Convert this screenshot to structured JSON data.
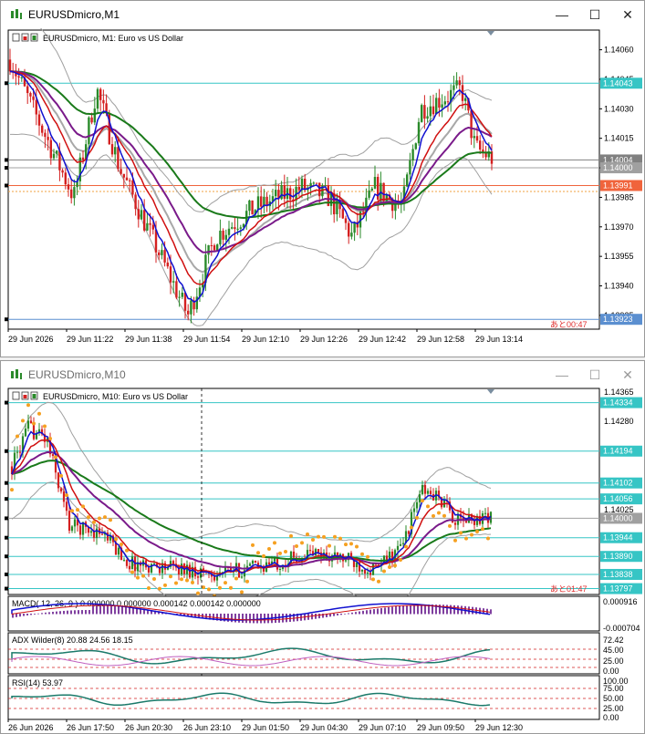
{
  "window1": {
    "title": "EURUSDmicro,M1",
    "chart_header": "EURUSDmicro, M1:  Euro vs US Dollar",
    "countdown": "あと00:47",
    "price_ticks": [
      "1.14060",
      "1.14045",
      "1.14030",
      "1.14015",
      "1.14000",
      "1.13985",
      "1.13970",
      "1.13955",
      "1.13940",
      "1.13925"
    ],
    "price_tags": [
      {
        "label": "1.14043",
        "color": "#36c5c5",
        "price": 1.14043
      },
      {
        "label": "1.14004",
        "color": "#808080",
        "price": 1.14004
      },
      {
        "label": "1.14000",
        "color": "#a0a0a0",
        "price": 1.14
      },
      {
        "label": "1.13991",
        "color": "#f0643c",
        "price": 1.13991
      },
      {
        "label": "1.13923",
        "color": "#5b8fd0",
        "price": 1.13923
      }
    ],
    "time_labels": [
      "29 Jun 2026",
      "29 Jun 11:22",
      "29 Jun 11:38",
      "29 Jun 11:54",
      "29 Jun 12:10",
      "29 Jun 12:26",
      "29 Jun 12:42",
      "29 Jun 12:58",
      "29 Jun 13:14"
    ]
  },
  "window2": {
    "title": "EURUSDmicro,M10",
    "chart_header": "EURUSDmicro, M10:  Euro vs US Dollar",
    "countdown": "あと01:47",
    "price_ticks": [
      "1.14365",
      "1.14334",
      "1.14280",
      "1.14194",
      "1.14102",
      "1.14056",
      "1.14025",
      "1.14000",
      "1.13944",
      "1.13890",
      "1.13838",
      "1.13797"
    ],
    "price_tags": [
      {
        "label": "1.14334",
        "color": "#36c5c5",
        "price": 1.14334
      },
      {
        "label": "1.14194",
        "color": "#36c5c5",
        "price": 1.14194
      },
      {
        "label": "1.14102",
        "color": "#36c5c5",
        "price": 1.14102
      },
      {
        "label": "1.14056",
        "color": "#36c5c5",
        "price": 1.14056
      },
      {
        "label": "1.14000",
        "color": "#a0a0a0",
        "price": 1.14
      },
      {
        "label": "1.13944",
        "color": "#36c5c5",
        "price": 1.13944
      },
      {
        "label": "1.13890",
        "color": "#36c5c5",
        "price": 1.1389
      },
      {
        "label": "1.13838",
        "color": "#36c5c5",
        "price": 1.13838
      },
      {
        "label": "1.13797",
        "color": "#36c5c5",
        "price": 1.13797
      }
    ],
    "macd_label": "MACD( 12, 26, 9 ) 0.000000  0.000000  0.000142  0.000142  0.000000",
    "macd_ticks": [
      "0.000916",
      "-0.000704"
    ],
    "adx_label": "ADX Wilder(8) 20.88  24.56  18.15",
    "adx_ticks": [
      "72.42",
      "45.00",
      "25.00",
      "0.00"
    ],
    "rsi_label": "RSI(14) 53.97",
    "rsi_ticks": [
      "100.00",
      "75.00",
      "50.00",
      "25.00",
      "0.00"
    ],
    "time_labels": [
      "26 Jun 2026",
      "26 Jun 17:50",
      "26 Jun 20:30",
      "26 Jun 23:10",
      "29 Jun 01:50",
      "29 Jun 04:30",
      "29 Jun 07:10",
      "29 Jun 09:50",
      "29 Jun 12:30"
    ]
  },
  "colors": {
    "bull": "#2a8a2a",
    "bear": "#d42020",
    "ma_blue": "#1010d0",
    "ma_red": "#d01010",
    "ma_purple": "#7a1a8a",
    "ma_green": "#1a7a1a",
    "bands": "#a0a0a0",
    "psar": "#f5a020",
    "cyan_line": "#36c5c5",
    "countdown": "#e03030"
  }
}
